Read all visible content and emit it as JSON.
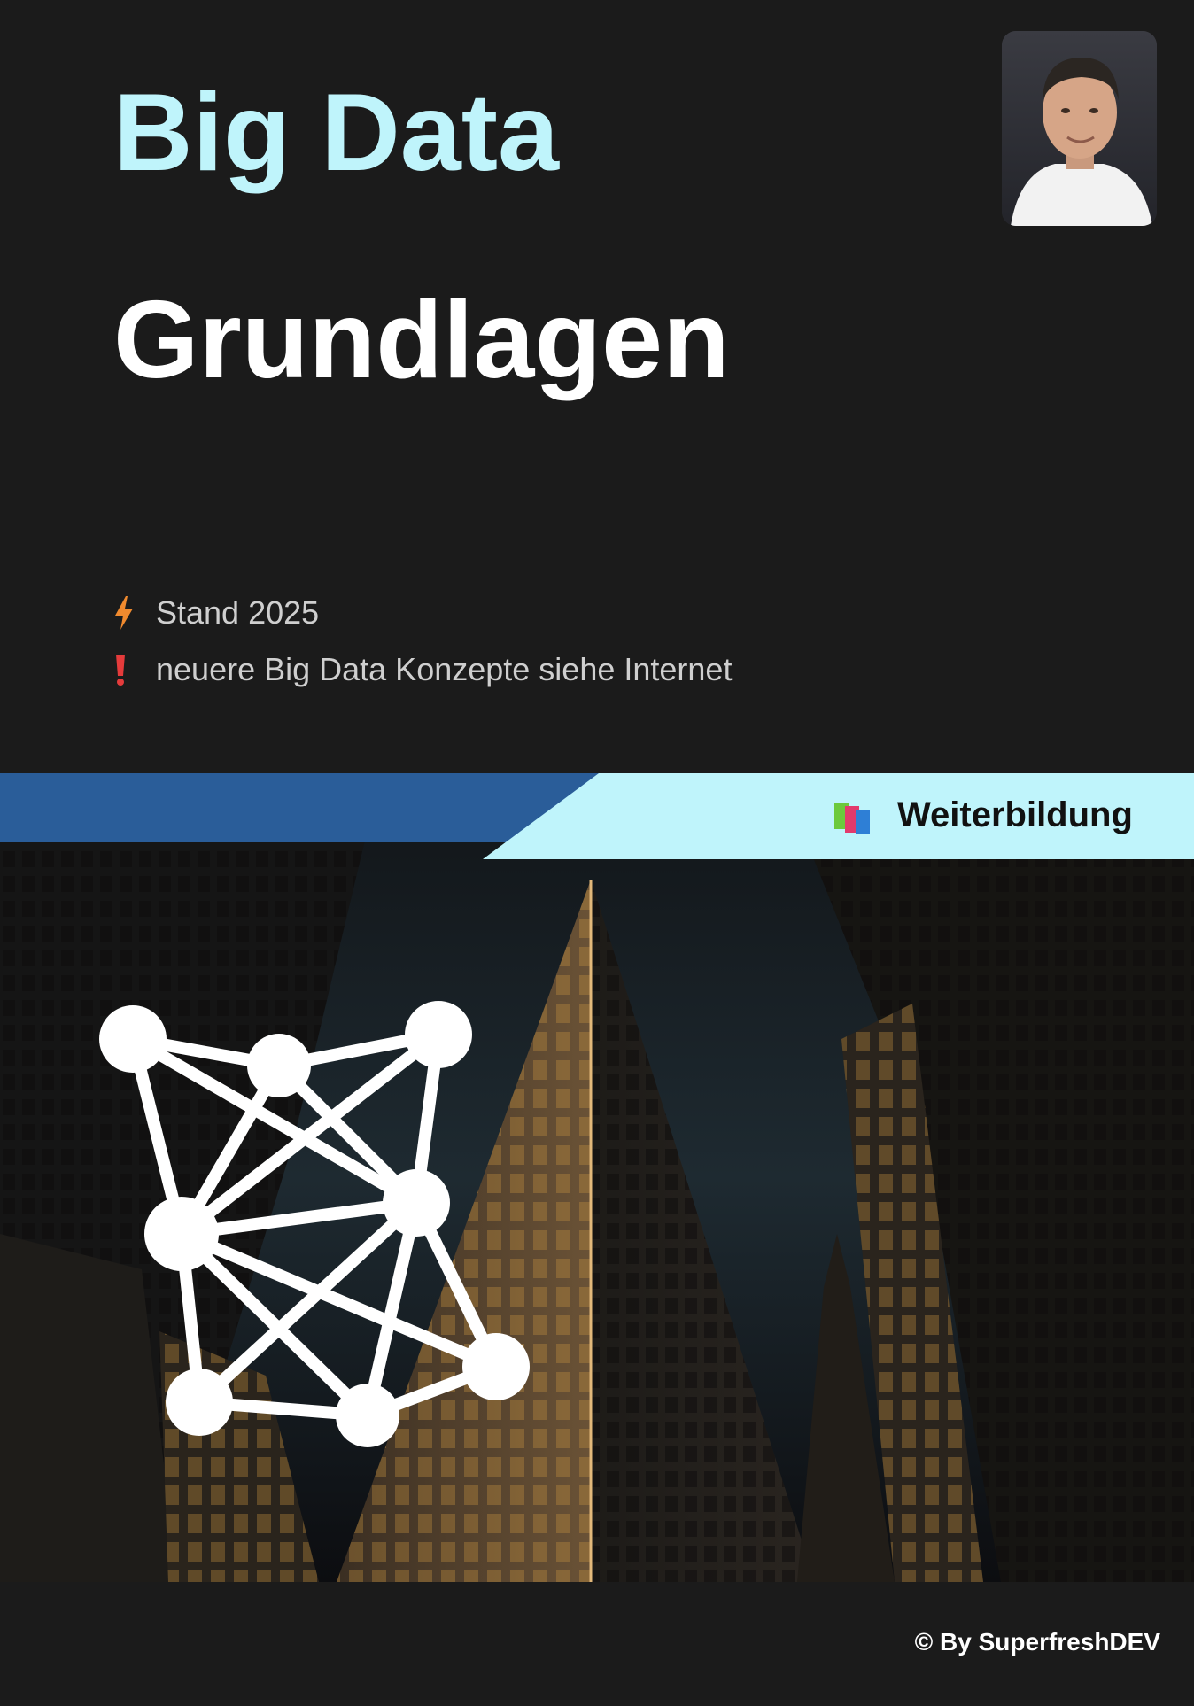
{
  "cover": {
    "title_line1": "Big Data",
    "title_line2": "Grundlagen",
    "accent_color": "#bff4fb",
    "background_color": "#1b1b1b"
  },
  "meta": [
    {
      "icon": "lightning-icon",
      "text": "Stand 2025"
    },
    {
      "icon": "exclamation-icon",
      "text": "neuere Big Data Konzepte siehe Internet"
    }
  ],
  "banner": {
    "label": "Weiterbildung",
    "icon": "books-icon",
    "left_color": "#2a5d99",
    "right_color": "#bff4fb"
  },
  "hero": {
    "description_icon": "network-icon"
  },
  "footer": {
    "credit": "© By SuperfreshDEV"
  }
}
